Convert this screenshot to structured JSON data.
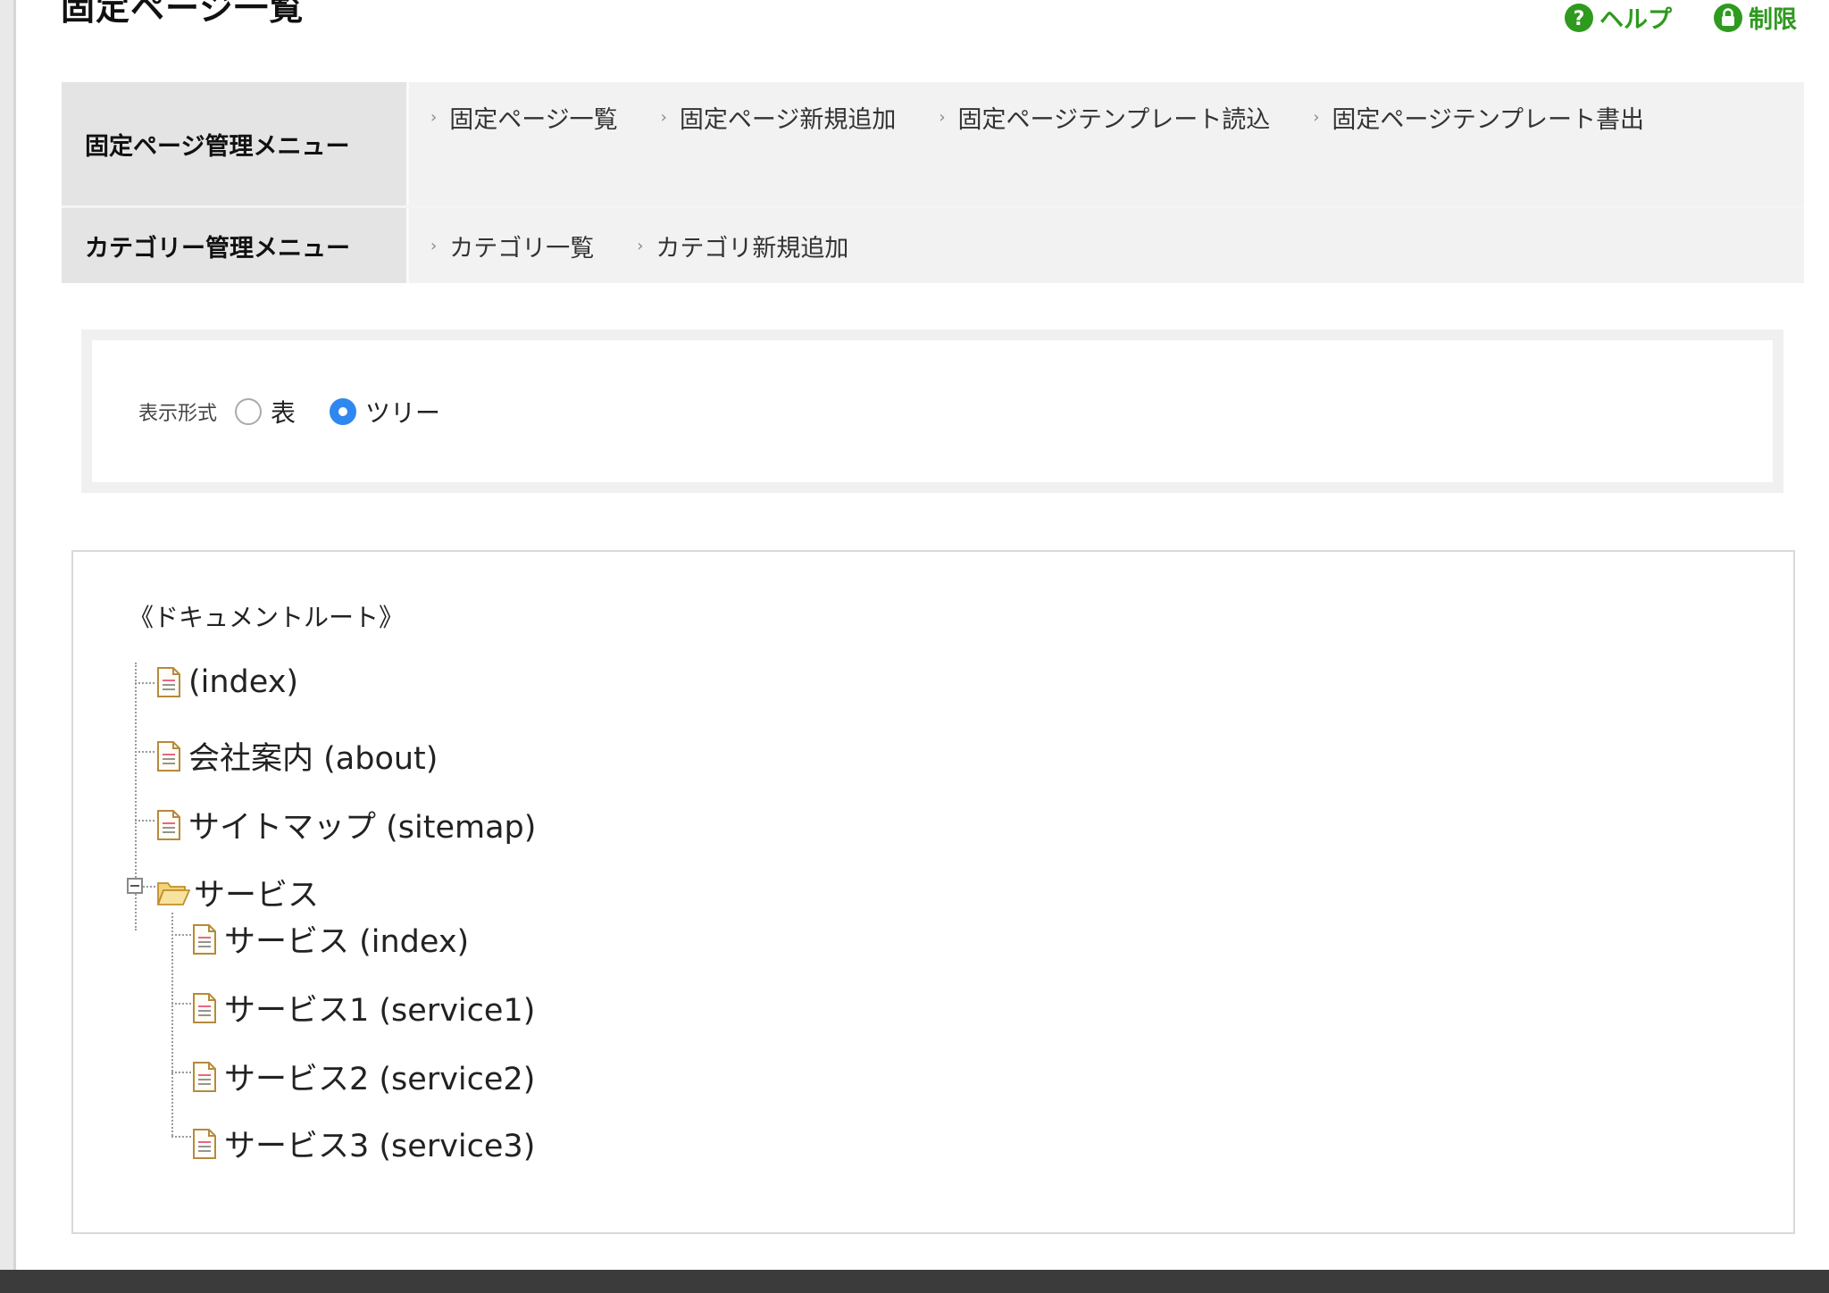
{
  "page": {
    "title": "固定ページ一覧"
  },
  "top_links": [
    {
      "label": "ヘルプ",
      "icon": "help-icon",
      "color": "#2e9a1e"
    },
    {
      "label": "制限",
      "icon": "lock-icon",
      "color": "#2e9a1e"
    }
  ],
  "menus": [
    {
      "heading": "固定ページ管理メニュー",
      "links": [
        "固定ページ一覧",
        "固定ページ新規追加",
        "固定ページテンプレート読込",
        "固定ページテンプレート書出"
      ]
    },
    {
      "heading": "カテゴリー管理メニュー",
      "links": [
        "カテゴリ一覧",
        "カテゴリ新規追加"
      ]
    }
  ],
  "display_mode": {
    "label": "表示形式",
    "options": [
      {
        "label": "表",
        "checked": false
      },
      {
        "label": "ツリー",
        "checked": true
      }
    ]
  },
  "tree": {
    "root": "《ドキュメントルート》",
    "items": [
      {
        "label": "(index)",
        "type": "page"
      },
      {
        "label": "会社案内 (about)",
        "type": "page"
      },
      {
        "label": "サイトマップ (sitemap)",
        "type": "page"
      },
      {
        "label": "サービス",
        "type": "folder",
        "expanded": true,
        "children": [
          {
            "label": "サービス (index)",
            "type": "page"
          },
          {
            "label": "サービス1 (service1)",
            "type": "page"
          },
          {
            "label": "サービス2 (service2)",
            "type": "page"
          },
          {
            "label": "サービス3 (service3)",
            "type": "page"
          }
        ]
      }
    ]
  }
}
